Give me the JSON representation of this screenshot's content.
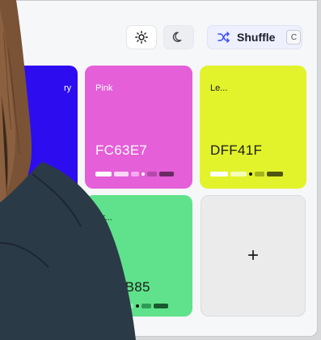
{
  "toolbar": {
    "light_icon": "sun-icon",
    "dark_icon": "moon-icon",
    "shuffle_icon": "shuffle-icon",
    "shuffle_label": "Shuffle",
    "shuffle_shortcut": "C"
  },
  "swatches": [
    {
      "name": "ry",
      "hex": "",
      "color": "#2d0df0",
      "text_color": "#ffffff"
    },
    {
      "name": "Pink",
      "hex": "FC63E7",
      "color": "#e45fd8",
      "text_color": "#ffffff"
    },
    {
      "name": "Le...",
      "hex": "DFF41F",
      "color": "#e2f32b",
      "text_color": "#1a1a1a"
    },
    {
      "name": "Gr...",
      "hex": "EB85",
      "color": "#5fe28b",
      "text_color": "#1a1a1a"
    }
  ],
  "add_tile": {
    "label": "+"
  },
  "colors": {
    "accent": "#3a4bff"
  }
}
